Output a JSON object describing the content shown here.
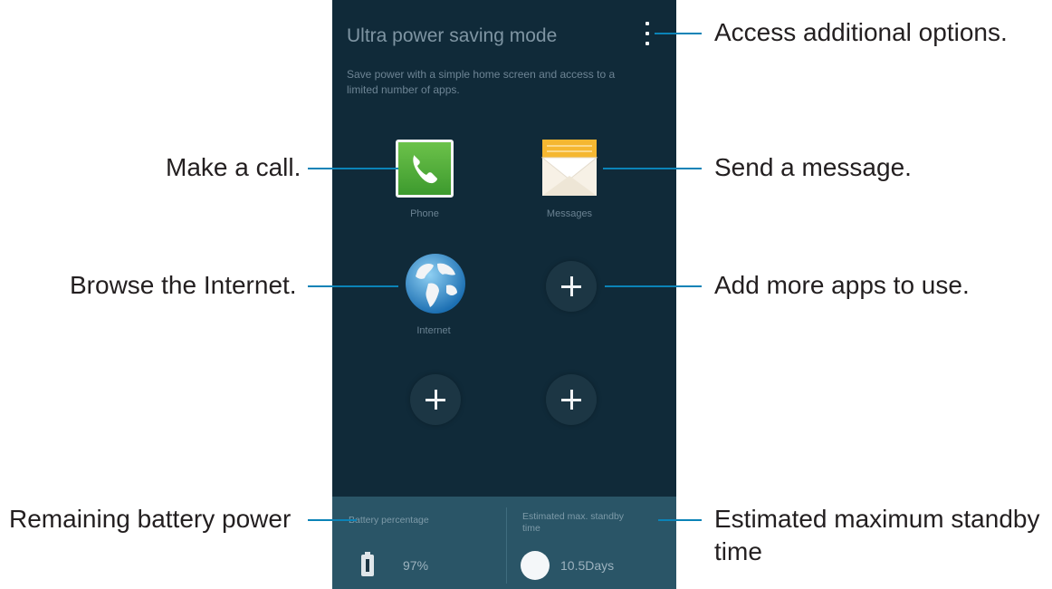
{
  "phone": {
    "title": "Ultra power saving mode",
    "description": "Save power with a simple home screen and access to a limited number of apps.",
    "apps": [
      {
        "label": "Phone",
        "icon": "phone-icon"
      },
      {
        "label": "Messages",
        "icon": "messages-icon"
      },
      {
        "label": "Internet",
        "icon": "globe-icon"
      }
    ],
    "bottom": {
      "battery_label": "Battery percentage",
      "battery_value": "97%",
      "standby_label": "Estimated max. standby time",
      "standby_value": "10.5Days"
    }
  },
  "callouts": {
    "options": "Access additional options.",
    "call": "Make a call.",
    "message": "Send a message.",
    "internet": "Browse the Internet.",
    "add_apps": "Add more apps to use.",
    "battery": "Remaining battery power",
    "standby_line1": "Estimated maximum standby",
    "standby_line2": "time"
  },
  "colors": {
    "screen_bg": "#102a39",
    "bottom_panel": "#2a5567",
    "leader_line": "#0b83b7",
    "callout_text": "#231f20"
  }
}
